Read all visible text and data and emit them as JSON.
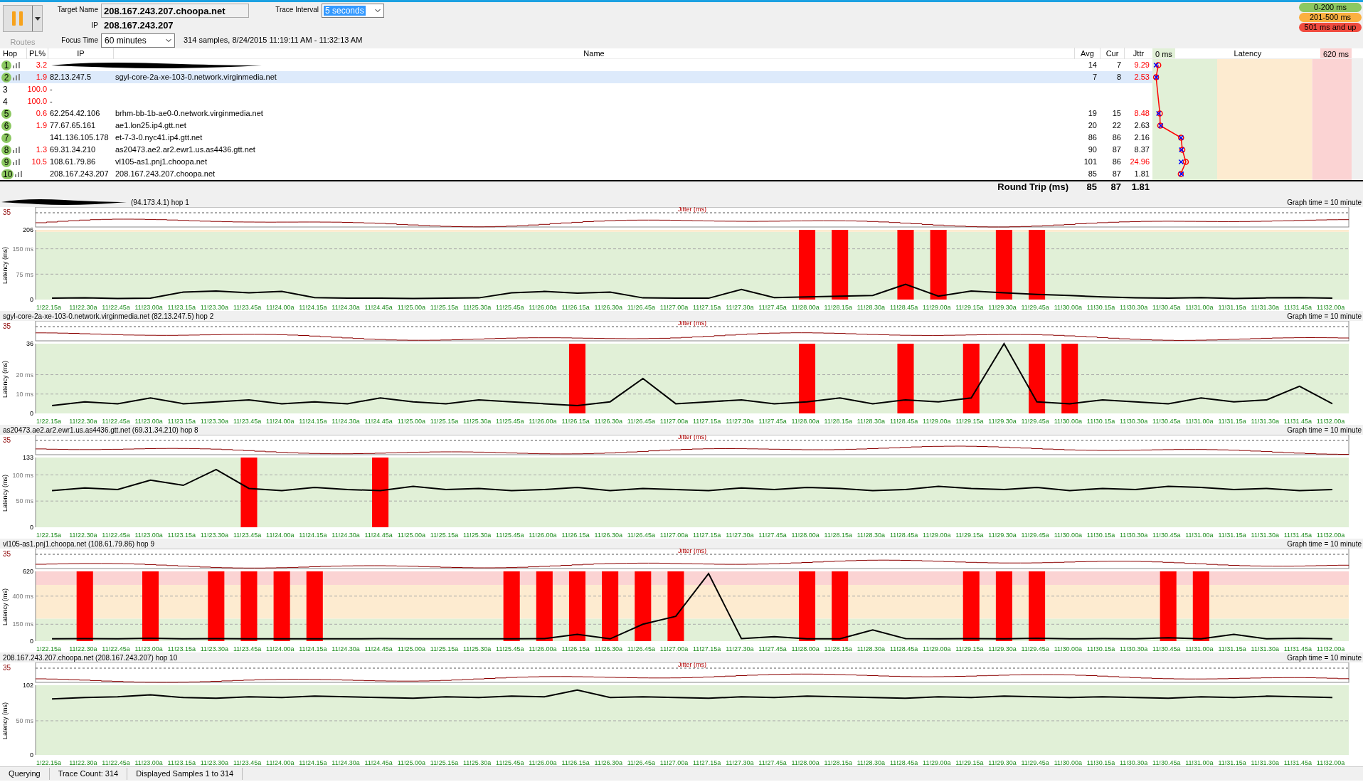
{
  "toolbar": {
    "routes": "Routes",
    "paused": true,
    "target_label": "Target Name",
    "target": "208.167.243.207.choopa.net",
    "ip_label": "IP",
    "ip": "208.167.243.207",
    "interval_label": "Trace Interval",
    "interval": {
      "value": "5 seconds",
      "highlighted": true
    },
    "focus_label": "Focus Time",
    "focus": "60 minutes",
    "samples": "314 samples, 8/24/2015 11:19:11 AM - 11:32:13 AM"
  },
  "legend": [
    {
      "label": "0-200 ms",
      "color": "#8cc861"
    },
    {
      "label": "201-500 ms",
      "color": "#fbb040"
    },
    {
      "label": "501 ms and up",
      "color": "#f04b3f"
    }
  ],
  "table": {
    "columns": [
      "Hop",
      "PL%",
      "IP",
      "Name",
      "Avg",
      "Cur",
      "Jttr"
    ],
    "latency_scale": {
      "title": "Latency",
      "min": "0 ms",
      "max": "620 ms"
    },
    "rows": [
      {
        "hop": "1",
        "responding": true,
        "graph": true,
        "pl": "3.2",
        "redacted": true,
        "avg": "14",
        "cur": "7",
        "jitter": "9.29",
        "jitter_high": true,
        "selected": false
      },
      {
        "hop": "2",
        "responding": true,
        "graph": true,
        "pl": "1.9",
        "ip": "82.13.247.5",
        "name": "sgyl-core-2a-xe-103-0.network.virginmedia.net",
        "avg": "7",
        "cur": "8",
        "jitter": "2.53",
        "jitter_high": true,
        "selected": true
      },
      {
        "hop": "3",
        "responding": false,
        "graph": false,
        "pl": "100.0",
        "ip": "-",
        "selected": false
      },
      {
        "hop": "4",
        "responding": false,
        "graph": false,
        "pl": "100.0",
        "ip": "-",
        "selected": false
      },
      {
        "hop": "5",
        "responding": true,
        "graph": false,
        "pl": "0.6",
        "ip": "62.254.42.106",
        "name": "brhm-bb-1b-ae0-0.network.virginmedia.net",
        "avg": "19",
        "cur": "15",
        "jitter": "8.48",
        "jitter_high": true,
        "selected": false
      },
      {
        "hop": "6",
        "responding": true,
        "graph": false,
        "pl": "1.9",
        "ip": "77.67.65.161",
        "name": "ae1.lon25.ip4.gtt.net",
        "avg": "20",
        "cur": "22",
        "jitter": "2.63",
        "jitter_high": false,
        "selected": false
      },
      {
        "hop": "7",
        "responding": true,
        "graph": false,
        "ip": "141.136.105.178",
        "name": "et-7-3-0.nyc41.ip4.gtt.net",
        "avg": "86",
        "cur": "86",
        "jitter": "2.16",
        "jitter_high": false,
        "selected": false
      },
      {
        "hop": "8",
        "responding": true,
        "graph": true,
        "pl": "1.3",
        "ip": "69.31.34.210",
        "name": "as20473.ae2.ar2.ewr1.us.as4436.gtt.net",
        "avg": "90",
        "cur": "87",
        "jitter": "8.37",
        "jitter_high": false,
        "selected": false
      },
      {
        "hop": "9",
        "responding": true,
        "graph": true,
        "pl": "10.5",
        "ip": "108.61.79.86",
        "name": "vl105-as1.pnj1.choopa.net",
        "avg": "101",
        "cur": "86",
        "jitter": "24.96",
        "jitter_high": true,
        "selected": false
      },
      {
        "hop": "10",
        "responding": true,
        "graph": true,
        "ip": "208.167.243.207",
        "name": "208.167.243.207.choopa.net",
        "avg": "85",
        "cur": "87",
        "jitter": "1.81",
        "jitter_high": false,
        "selected": false
      }
    ],
    "round_trip": {
      "label": "Round Trip (ms)",
      "avg": "85",
      "cur": "87",
      "jitter": "1.81"
    }
  },
  "panels": [
    {
      "title": "(94.173.4.1) hop 1",
      "redacted": true,
      "graph_time": "Graph time = 10 minute",
      "jitter_label": "Jitter (ms)",
      "jitter_tick": "35",
      "chart_data": {
        "type": "line",
        "ylabel": "Latency (ms)",
        "ylim": [
          0,
          206
        ],
        "yticks": [
          {
            "value": 0,
            "label": "0"
          },
          {
            "value": 75,
            "label": "75 ms"
          },
          {
            "value": 150,
            "label": "150 ms"
          },
          {
            "value": 206,
            "label": "206"
          }
        ],
        "categories": [
          "1!22.15a",
          "11!22.30a",
          "11!22.45a",
          "11!23.00a",
          "11!23.15a",
          "11!23.30a",
          "11!23.45a",
          "11!24.00a",
          "11!24.15a",
          "11!24.30a",
          "11!24.45a",
          "11!25.00a",
          "11!25.15a",
          "11!25.30a",
          "11!25.45a",
          "11!26.00a",
          "11!26.15a",
          "11!26.30a",
          "11!26.45a",
          "11!27.00a",
          "11!27.15a",
          "11!27.30a",
          "11!27.45a",
          "11!28.00a",
          "11!28.15a",
          "11!28.30a",
          "11!28.45a",
          "11!29.00a",
          "11!29.15a",
          "11!29.30a",
          "11!29.45a",
          "11!30.00a",
          "11!30.15a",
          "11!30.30a",
          "11!30.45a",
          "11!31.00a",
          "11!31.15a",
          "11!31.30a",
          "11!31.45a",
          "11!32.00a"
        ],
        "series": [
          {
            "color": "#000000",
            "values": [
              4,
              5,
              3,
              4,
              22,
              25,
              20,
              24,
              6,
              4,
              4,
              3,
              4,
              5,
              20,
              24,
              19,
              22,
              5,
              4,
              4,
              30,
              6,
              8,
              10,
              12,
              45,
              10,
              25,
              20,
              15,
              12,
              8,
              5,
              4,
              6,
              3,
              5,
              6,
              4
            ]
          },
          {
            "type": "bar",
            "color": "#ff0000",
            "values": [
              null,
              null,
              null,
              null,
              null,
              null,
              null,
              null,
              null,
              null,
              null,
              null,
              null,
              null,
              null,
              null,
              null,
              null,
              null,
              null,
              null,
              null,
              null,
              206,
              206,
              null,
              206,
              206,
              null,
              206,
              206,
              null,
              null,
              null,
              null,
              null,
              null,
              null,
              null,
              null
            ]
          }
        ]
      }
    },
    {
      "title": "sgyl-core-2a-xe-103-0.network.virginmedia.net (82.13.247.5) hop 2",
      "graph_time": "Graph time = 10 minute",
      "jitter_label": "Jitter (ms)",
      "jitter_tick": "35",
      "chart_data": {
        "type": "line",
        "ylabel": "Latency (ms)",
        "ylim": [
          0,
          36
        ],
        "yticks": [
          {
            "value": 0,
            "label": "0"
          },
          {
            "value": 10,
            "label": "10 ms"
          },
          {
            "value": 20,
            "label": "20 ms"
          },
          {
            "value": 36,
            "label": "36"
          }
        ],
        "categories": [
          "1!22.15a",
          "11!22.30a",
          "11!22.45a",
          "11!23.00a",
          "11!23.15a",
          "11!23.30a",
          "11!23.45a",
          "11!24.00a",
          "11!24.15a",
          "11!24.30a",
          "11!24.45a",
          "11!25.00a",
          "11!25.15a",
          "11!25.30a",
          "11!25.45a",
          "11!26.00a",
          "11!26.15a",
          "11!26.30a",
          "11!26.45a",
          "11!27.00a",
          "11!27.15a",
          "11!27.30a",
          "11!27.45a",
          "11!28.00a",
          "11!28.15a",
          "11!28.30a",
          "11!28.45a",
          "11!29.00a",
          "11!29.15a",
          "11!29.30a",
          "11!29.45a",
          "11!30.00a",
          "11!30.15a",
          "11!30.30a",
          "11!30.45a",
          "11!31.00a",
          "11!31.15a",
          "11!31.30a",
          "11!31.45a",
          "11!32.00a"
        ],
        "series": [
          {
            "color": "#000000",
            "values": [
              4,
              6,
              5,
              8,
              5,
              6,
              7,
              5,
              6,
              5,
              8,
              6,
              5,
              7,
              6,
              5,
              4,
              6,
              18,
              5,
              6,
              7,
              5,
              6,
              8,
              5,
              7,
              6,
              8,
              36,
              6,
              5,
              7,
              6,
              5,
              8,
              6,
              7,
              14,
              5
            ]
          },
          {
            "type": "bar",
            "color": "#ff0000",
            "values": [
              null,
              null,
              null,
              null,
              null,
              null,
              null,
              null,
              null,
              null,
              null,
              null,
              null,
              null,
              null,
              null,
              36,
              null,
              null,
              null,
              null,
              null,
              null,
              36,
              null,
              null,
              36,
              null,
              36,
              null,
              36,
              36,
              null,
              null,
              null,
              null,
              null,
              null,
              null,
              null
            ]
          }
        ]
      }
    },
    {
      "title": "as20473.ae2.ar2.ewr1.us.as4436.gtt.net (69.31.34.210) hop 8",
      "graph_time": "Graph time = 10 minute",
      "jitter_label": "Jitter (ms)",
      "jitter_tick": "35",
      "chart_data": {
        "type": "line",
        "ylabel": "Latency (ms)",
        "ylim": [
          0,
          133
        ],
        "yticks": [
          {
            "value": 0,
            "label": "0"
          },
          {
            "value": 50,
            "label": "50 ms"
          },
          {
            "value": 100,
            "label": "100 ms"
          },
          {
            "value": 133,
            "label": "133"
          }
        ],
        "categories": [
          "1!22.15a",
          "11!22.30a",
          "11!22.45a",
          "11!23.00a",
          "11!23.15a",
          "11!23.30a",
          "11!23.45a",
          "11!24.00a",
          "11!24.15a",
          "11!24.30a",
          "11!24.45a",
          "11!25.00a",
          "11!25.15a",
          "11!25.30a",
          "11!25.45a",
          "11!26.00a",
          "11!26.15a",
          "11!26.30a",
          "11!26.45a",
          "11!27.00a",
          "11!27.15a",
          "11!27.30a",
          "11!27.45a",
          "11!28.00a",
          "11!28.15a",
          "11!28.30a",
          "11!28.45a",
          "11!29.00a",
          "11!29.15a",
          "11!29.30a",
          "11!29.45a",
          "11!30.00a",
          "11!30.15a",
          "11!30.30a",
          "11!30.45a",
          "11!31.00a",
          "11!31.15a",
          "11!31.30a",
          "11!31.45a",
          "11!32.00a"
        ],
        "series": [
          {
            "color": "#000000",
            "values": [
              70,
              75,
              72,
              90,
              80,
              110,
              74,
              70,
              76,
              72,
              70,
              78,
              72,
              74,
              70,
              72,
              76,
              70,
              74,
              72,
              70,
              75,
              72,
              76,
              74,
              70,
              72,
              78,
              74,
              72,
              76,
              70,
              74,
              72,
              78,
              76,
              72,
              74,
              70,
              72
            ]
          },
          {
            "type": "bar",
            "color": "#ff0000",
            "values": [
              null,
              null,
              null,
              null,
              null,
              null,
              133,
              null,
              null,
              null,
              133,
              null,
              null,
              null,
              null,
              null,
              null,
              null,
              null,
              null,
              null,
              null,
              null,
              null,
              null,
              null,
              null,
              null,
              null,
              null,
              null,
              null,
              null,
              null,
              null,
              null,
              null,
              null,
              null,
              null
            ]
          }
        ]
      }
    },
    {
      "title": "vl105-as1.pnj1.choopa.net (108.61.79.86) hop 9",
      "graph_time": "Graph time = 10 minute",
      "jitter_label": "Jitter (ms)",
      "jitter_tick": "35",
      "chart_data": {
        "type": "line",
        "ylabel": "Latency (ms)",
        "ylim": [
          0,
          620
        ],
        "yticks": [
          {
            "value": 0,
            "label": "0"
          },
          {
            "value": 150,
            "label": "150 ms"
          },
          {
            "value": 400,
            "label": "400 ms"
          },
          {
            "value": 620,
            "label": "620"
          }
        ],
        "categories": [
          "1!22.15a",
          "11!22.30a",
          "11!22.45a",
          "11!23.00a",
          "11!23.15a",
          "11!23.30a",
          "11!23.45a",
          "11!24.00a",
          "11!24.15a",
          "11!24.30a",
          "11!24.45a",
          "11!25.00a",
          "11!25.15a",
          "11!25.30a",
          "11!25.45a",
          "11!26.00a",
          "11!26.15a",
          "11!26.30a",
          "11!26.45a",
          "11!27.00a",
          "11!27.15a",
          "11!27.30a",
          "11!27.45a",
          "11!28.00a",
          "11!28.15a",
          "11!28.30a",
          "11!28.45a",
          "11!29.00a",
          "11!29.15a",
          "11!29.30a",
          "11!29.45a",
          "11!30.00a",
          "11!30.15a",
          "11!30.30a",
          "11!30.45a",
          "11!31.00a",
          "11!31.15a",
          "11!31.30a",
          "11!31.45a",
          "11!32.00a"
        ],
        "series": [
          {
            "color": "#000000",
            "values": [
              20,
              22,
              20,
              25,
              20,
              22,
              20,
              21,
              20,
              20,
              22,
              20,
              21,
              20,
              20,
              22,
              60,
              20,
              150,
              220,
              600,
              22,
              40,
              20,
              20,
              100,
              22,
              20,
              22,
              20,
              25,
              20,
              22,
              20,
              30,
              20,
              60,
              20,
              25,
              20
            ]
          },
          {
            "type": "bar",
            "color": "#ff0000",
            "values": [
              null,
              620,
              null,
              620,
              null,
              620,
              620,
              620,
              620,
              null,
              null,
              null,
              null,
              null,
              620,
              620,
              620,
              620,
              620,
              620,
              null,
              null,
              null,
              620,
              620,
              null,
              null,
              null,
              620,
              620,
              620,
              null,
              null,
              null,
              620,
              620,
              null,
              null,
              null,
              null
            ]
          }
        ]
      }
    },
    {
      "title": "208.167.243.207.choopa.net (208.167.243.207) hop 10",
      "graph_time": "Graph time = 10 minute",
      "jitter_label": "Jitter (ms)",
      "jitter_tick": "35",
      "chart_data": {
        "type": "line",
        "ylabel": "Latency (ms)",
        "ylim": [
          0,
          102
        ],
        "yticks": [
          {
            "value": 0,
            "label": "0"
          },
          {
            "value": 50,
            "label": "50 ms"
          },
          {
            "value": 102,
            "label": "102"
          }
        ],
        "categories": [
          "1!22.15a",
          "11!22.30a",
          "11!22.45a",
          "11!23.00a",
          "11!23.15a",
          "11!23.30a",
          "11!23.45a",
          "11!24.00a",
          "11!24.15a",
          "11!24.30a",
          "11!24.45a",
          "11!25.00a",
          "11!25.15a",
          "11!25.30a",
          "11!25.45a",
          "11!26.00a",
          "11!26.15a",
          "11!26.30a",
          "11!26.45a",
          "11!27.00a",
          "11!27.15a",
          "11!27.30a",
          "11!27.45a",
          "11!28.00a",
          "11!28.15a",
          "11!28.30a",
          "11!28.45a",
          "11!29.00a",
          "11!29.15a",
          "11!29.30a",
          "11!29.45a",
          "11!30.00a",
          "11!30.15a",
          "11!30.30a",
          "11!30.45a",
          "11!31.00a",
          "11!31.15a",
          "11!31.30a",
          "11!31.45a",
          "11!32.00a"
        ],
        "series": [
          {
            "color": "#000000",
            "values": [
              82,
              84,
              85,
              88,
              84,
              83,
              85,
              84,
              86,
              85,
              84,
              83,
              85,
              84,
              86,
              85,
              95,
              84,
              85,
              84,
              83,
              85,
              84,
              86,
              85,
              84,
              83,
              85,
              84,
              86,
              85,
              84,
              85,
              84,
              83,
              85,
              84,
              86,
              85,
              84
            ]
          }
        ]
      }
    }
  ],
  "status_bar": [
    "Querying",
    "Trace Count: 314",
    "Displayed Samples 1 to 314"
  ]
}
